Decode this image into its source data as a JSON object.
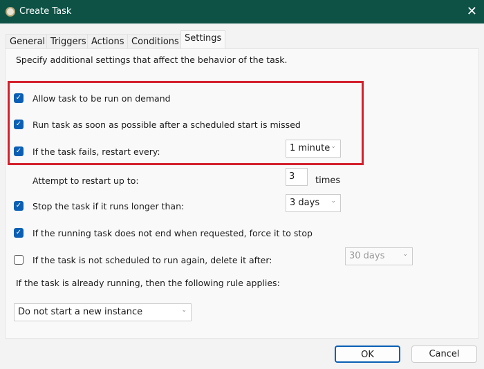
{
  "window": {
    "title": "Create Task",
    "close_icon": "close-icon",
    "app_icon": "clock-icon"
  },
  "tabs": [
    {
      "label": "General"
    },
    {
      "label": "Triggers"
    },
    {
      "label": "Actions"
    },
    {
      "label": "Conditions"
    },
    {
      "label": "Settings",
      "active": true
    }
  ],
  "settings": {
    "intro": "Specify additional settings that affect the behavior of the task.",
    "allow_on_demand": {
      "label": "Allow task to be run on demand",
      "checked": true
    },
    "run_missed": {
      "label": "Run task as soon as possible after a scheduled start is missed",
      "checked": true
    },
    "restart_on_fail": {
      "label": "If the task fails, restart every:",
      "checked": true,
      "value": "1 minute"
    },
    "restart_attempts": {
      "label": "Attempt to restart up to:",
      "value": "3",
      "unit": "times"
    },
    "stop_long": {
      "label": "Stop the task if it runs longer than:",
      "checked": true,
      "value": "3 days"
    },
    "force_stop": {
      "label": "If the running task does not end when requested, force it to stop",
      "checked": true
    },
    "delete_after": {
      "label": "If the task is not scheduled to run again, delete it after:",
      "checked": false,
      "value": "30 days"
    },
    "rule_label": "If the task is already running, then the following rule applies:",
    "rule_value": "Do not start a new instance"
  },
  "buttons": {
    "ok": "OK",
    "cancel": "Cancel"
  },
  "highlight_color": "#d4202d",
  "accent": "#0a5fb4"
}
